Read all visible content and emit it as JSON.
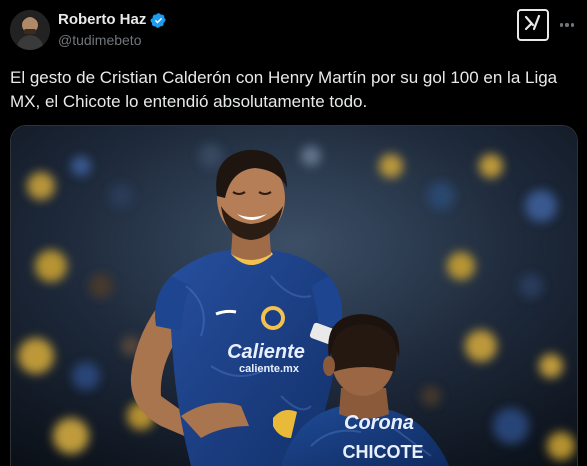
{
  "author": {
    "display_name": "Roberto Haz",
    "handle": "@tudimebeto",
    "verified": true,
    "avatar_icon": "profile-photo"
  },
  "tweet": {
    "text": "El gesto de Cristian Calderón con Henry Martín por su gol 100 en la Liga MX, el Chicote lo entendió absolutamente todo."
  },
  "actions": {
    "grok_icon": "grok-icon",
    "more_icon": "more-dots-icon"
  },
  "photo": {
    "jersey_sponsor": "Caliente",
    "jersey_sponsor_sub": "caliente.mx",
    "back_sponsor": "Corona",
    "back_name": "CHICOTE"
  },
  "colors": {
    "background": "#000000",
    "text": "#e7e9ea",
    "secondary_text": "#71767b",
    "verified_blue": "#1d9bf0",
    "jersey_blue": "#1a3f86"
  }
}
